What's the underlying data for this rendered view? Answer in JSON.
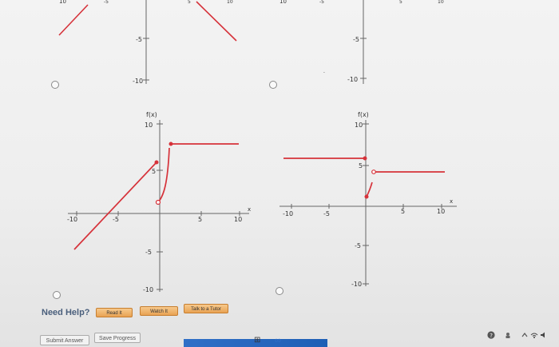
{
  "top_graphs": {
    "left_labels": {
      "tick_neg5": "-5",
      "tick_neg10": "-10",
      "tick_top": "10"
    },
    "right_labels": {
      "tick_neg5": "-5",
      "tick_neg10": "-10",
      "tick_top": "10"
    }
  },
  "graph_c": {
    "ylabel": "f(x)",
    "xlabel": "x",
    "ticks": {
      "x_neg10": "-10",
      "x_neg5": "-5",
      "x_5": "5",
      "x_10": "10",
      "y_10": "10",
      "y_5": "5",
      "y_neg5": "-5",
      "y_neg10": "-10"
    }
  },
  "graph_d": {
    "ylabel": "f(x)",
    "xlabel": "x",
    "ticks": {
      "x_neg10": "-10",
      "x_neg5": "-5",
      "x_5": "5",
      "x_10": "10",
      "y_10": "10",
      "y_5": "5",
      "y_neg5": "-5",
      "y_neg10": "-10"
    }
  },
  "help": {
    "label": "Need Help?",
    "read_it": "Read It",
    "watch_it": "Watch It",
    "talk_to_tutor": "Talk to a Tutor"
  },
  "form": {
    "submit_answer": "Submit Answer",
    "save_progress": "Save Progress"
  },
  "colors": {
    "curve": "#d6323a",
    "axis": "#666666",
    "accent_button": "#e8a254"
  },
  "icons": [
    "help-circle-icon",
    "chevron-up-icon",
    "wifi-icon",
    "volume-icon"
  ]
}
